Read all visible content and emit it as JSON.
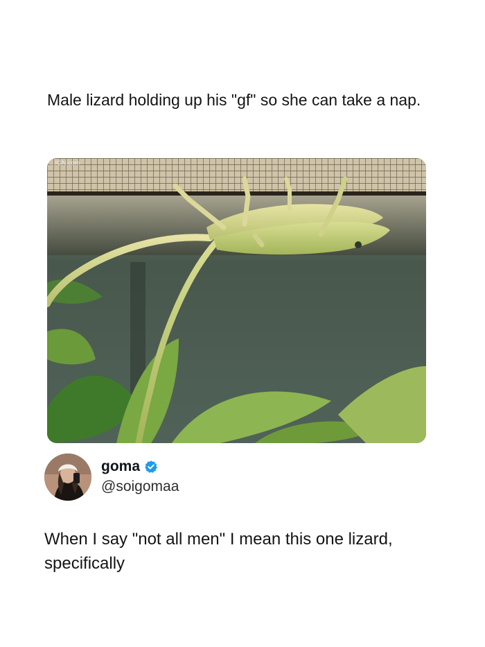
{
  "post": {
    "caption": "Male lizard holding up his \"gf\" so she can take a nap."
  },
  "image": {
    "watermark": "...IGN.com"
  },
  "tweet": {
    "display_name": "goma",
    "handle": "@soigomaa",
    "verified": true,
    "text": "When I say \"not all men\" I mean this one lizard, specifically"
  },
  "colors": {
    "verified_badge": "#1d9bf0",
    "text": "#141414"
  },
  "icons": {
    "verified": "verified-check-badge-icon"
  }
}
